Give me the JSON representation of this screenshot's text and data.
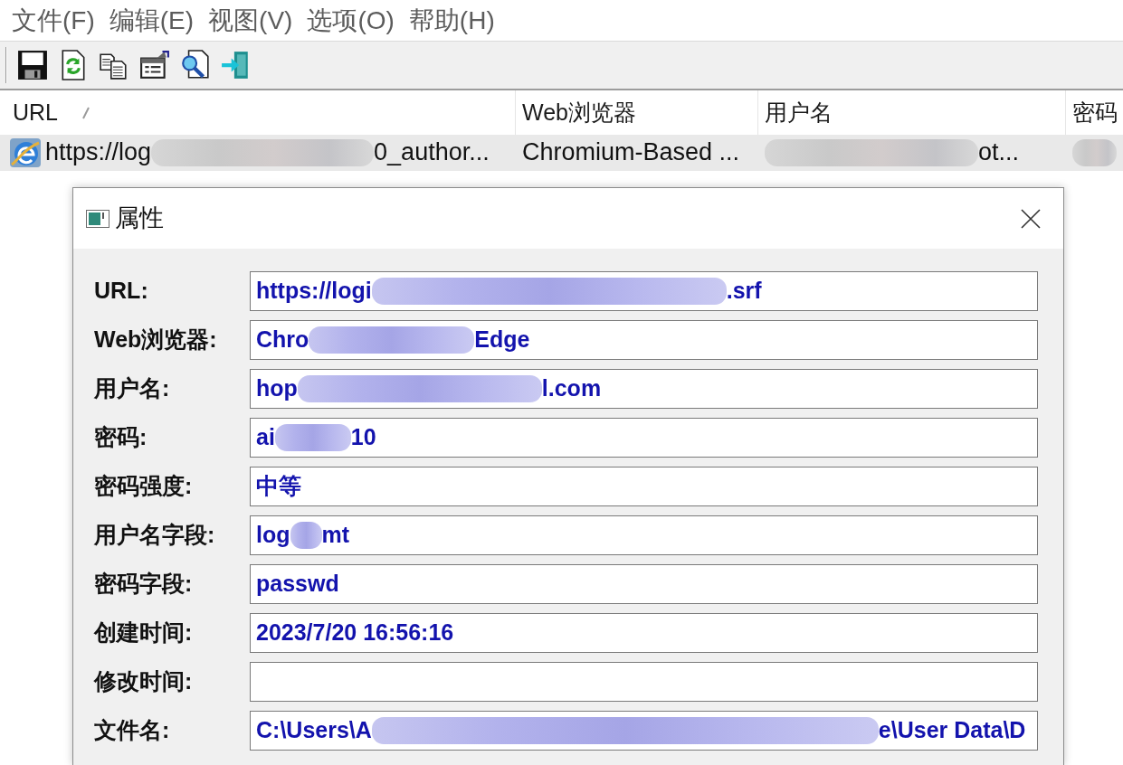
{
  "menu_bar": [
    "文件(F)",
    "编辑(E)",
    "视图(V)",
    "选项(O)",
    "帮助(H)"
  ],
  "table": {
    "columns": [
      {
        "label": "URL",
        "sorted": true
      },
      {
        "label": "Web浏览器",
        "sorted": false
      },
      {
        "label": "用户名",
        "sorted": false
      },
      {
        "label": "密码",
        "sorted": false
      }
    ],
    "rows": [
      {
        "selected": true,
        "cells": [
          [
            {
              "kind": "text",
              "text": "https://log"
            },
            {
              "kind": "blur"
            },
            {
              "kind": "text",
              "text": "0_author..."
            }
          ],
          [
            {
              "kind": "text",
              "text": "Chromium-Based ..."
            }
          ],
          [
            {
              "kind": "blur"
            },
            {
              "kind": "text",
              "text": "ot..."
            }
          ],
          [
            {
              "kind": "blur"
            }
          ]
        ]
      }
    ]
  },
  "dialog": {
    "title": "属性",
    "fields": [
      {
        "label": "URL:",
        "value": [
          {
            "kind": "text",
            "text": "https://logi"
          },
          {
            "kind": "blur"
          },
          {
            "kind": "text",
            "text": ".srf"
          }
        ]
      },
      {
        "label": "Web浏览器:",
        "value": [
          {
            "kind": "text",
            "text": "Chro"
          },
          {
            "kind": "blur"
          },
          {
            "kind": "text",
            "text": "Edge"
          }
        ]
      },
      {
        "label": "用户名:",
        "value": [
          {
            "kind": "text",
            "text": "hop"
          },
          {
            "kind": "blur"
          },
          {
            "kind": "text",
            "text": "l.com"
          }
        ]
      },
      {
        "label": "密码:",
        "value": [
          {
            "kind": "text",
            "text": "ai"
          },
          {
            "kind": "blur"
          },
          {
            "kind": "text",
            "text": "10"
          }
        ]
      },
      {
        "label": "密码强度:",
        "value": [
          {
            "kind": "text",
            "text": "中等"
          }
        ]
      },
      {
        "label": "用户名字段:",
        "value": [
          {
            "kind": "text",
            "text": "log"
          },
          {
            "kind": "blur"
          },
          {
            "kind": "text",
            "text": "mt"
          }
        ]
      },
      {
        "label": "密码字段:",
        "value": [
          {
            "kind": "text",
            "text": "passwd"
          }
        ]
      },
      {
        "label": "创建时间:",
        "value": [
          {
            "kind": "text",
            "text": "2023/7/20 16:56:16"
          }
        ]
      },
      {
        "label": "修改时间:"
      },
      {
        "label": "文件名:",
        "value": [
          {
            "kind": "text",
            "text": "C:\\Users\\A"
          },
          {
            "kind": "blur"
          },
          {
            "kind": "text",
            "text": "e\\User Data\\D"
          }
        ]
      }
    ]
  }
}
